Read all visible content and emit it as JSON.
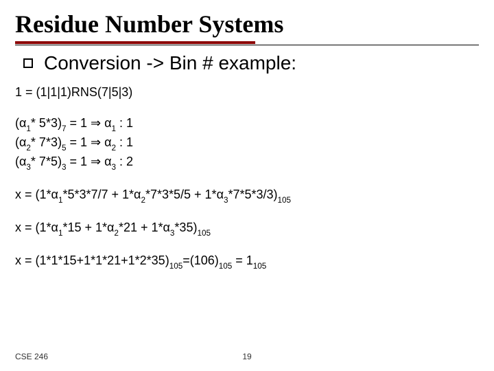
{
  "title": "Residue Number Systems",
  "heading": "Conversion -> Bin # example:",
  "line1_pre": "1 = (1|1|1)RNS(7|5|3)",
  "alpha_lines": {
    "a1_pre": "(",
    "a1_mid": "* 5*3)",
    "a1_exp": "7",
    "a1_eq": " = 1 ",
    "a1_res": " : 1",
    "a2_mid": "* 7*3)",
    "a2_exp": "5",
    "a2_eq": " = 1 ",
    "a2_res": " : 1",
    "a3_mid": "* 7*5)",
    "a3_exp": "3",
    "a3_eq": " = 1 ",
    "a3_res": " : 2"
  },
  "line_x1_a": "x = (1*",
  "line_x1_b": "*5*3*7/7 + 1*",
  "line_x1_c": "*7*3*5/5 + 1*",
  "line_x1_d": "*7*5*3/3)",
  "line_x1_sub": "105",
  "line_x2_a": "x = (1*",
  "line_x2_b": "*15 + 1*",
  "line_x2_c": "*21 + 1*",
  "line_x2_d": "*35)",
  "line_x2_sub": "105",
  "line_x3_a": "x = (1*1*15+1*1*21+1*2*35)",
  "line_x3_b": "=(106)",
  "line_x3_c": " = 1",
  "mod105": "105",
  "footer": {
    "course": "CSE 246",
    "page": "19"
  },
  "s1": "1",
  "s2": "2",
  "s3": "3"
}
